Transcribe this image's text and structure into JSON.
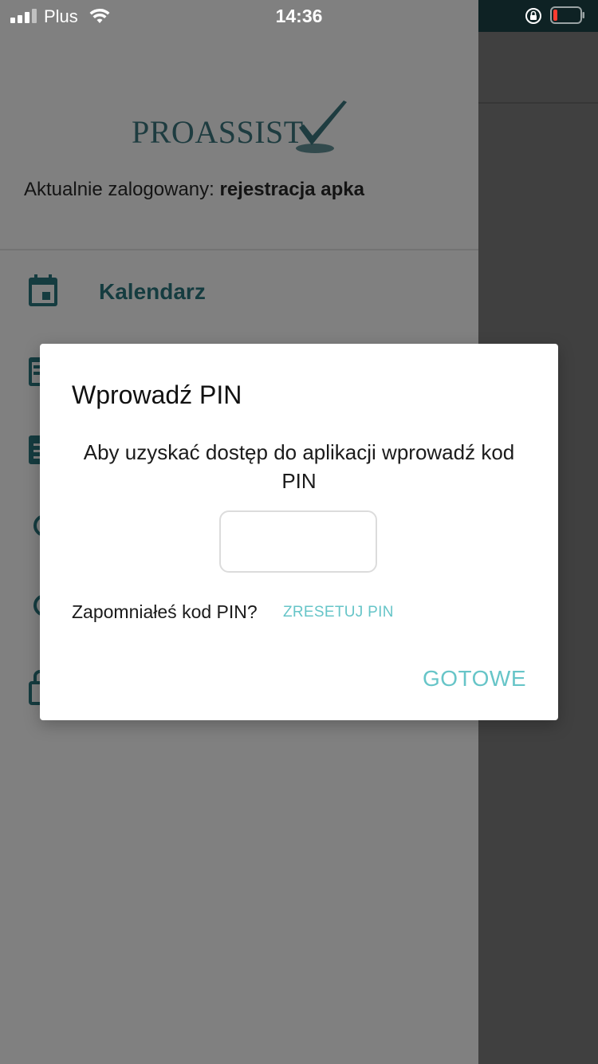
{
  "status_bar": {
    "carrier": "Plus",
    "time": "14:36",
    "icons": [
      "signal-icon",
      "wifi-icon",
      "rotation-lock-icon",
      "battery-icon"
    ],
    "battery_color": "#ff3b30"
  },
  "drawer": {
    "logo_text": "PROASSIST",
    "logged_in_prefix": "Aktualnie zalogowany: ",
    "logged_in_user": "rejestracja apka",
    "items": [
      {
        "label": "Kalendarz",
        "icon": "calendar-icon"
      }
    ]
  },
  "dialog": {
    "title": "Wprowadź PIN",
    "message": "Aby uzyskać dostęp do aplikacji wprowadź kod PIN",
    "pin_value": "",
    "forgot_text": "Zapomniałeś kod PIN?",
    "reset_label": "ZRESETUJ PIN",
    "done_label": "GOTOWE"
  },
  "colors": {
    "accent": "#67c5c8",
    "brand_dark": "#153c40",
    "overlay": "#808080"
  }
}
